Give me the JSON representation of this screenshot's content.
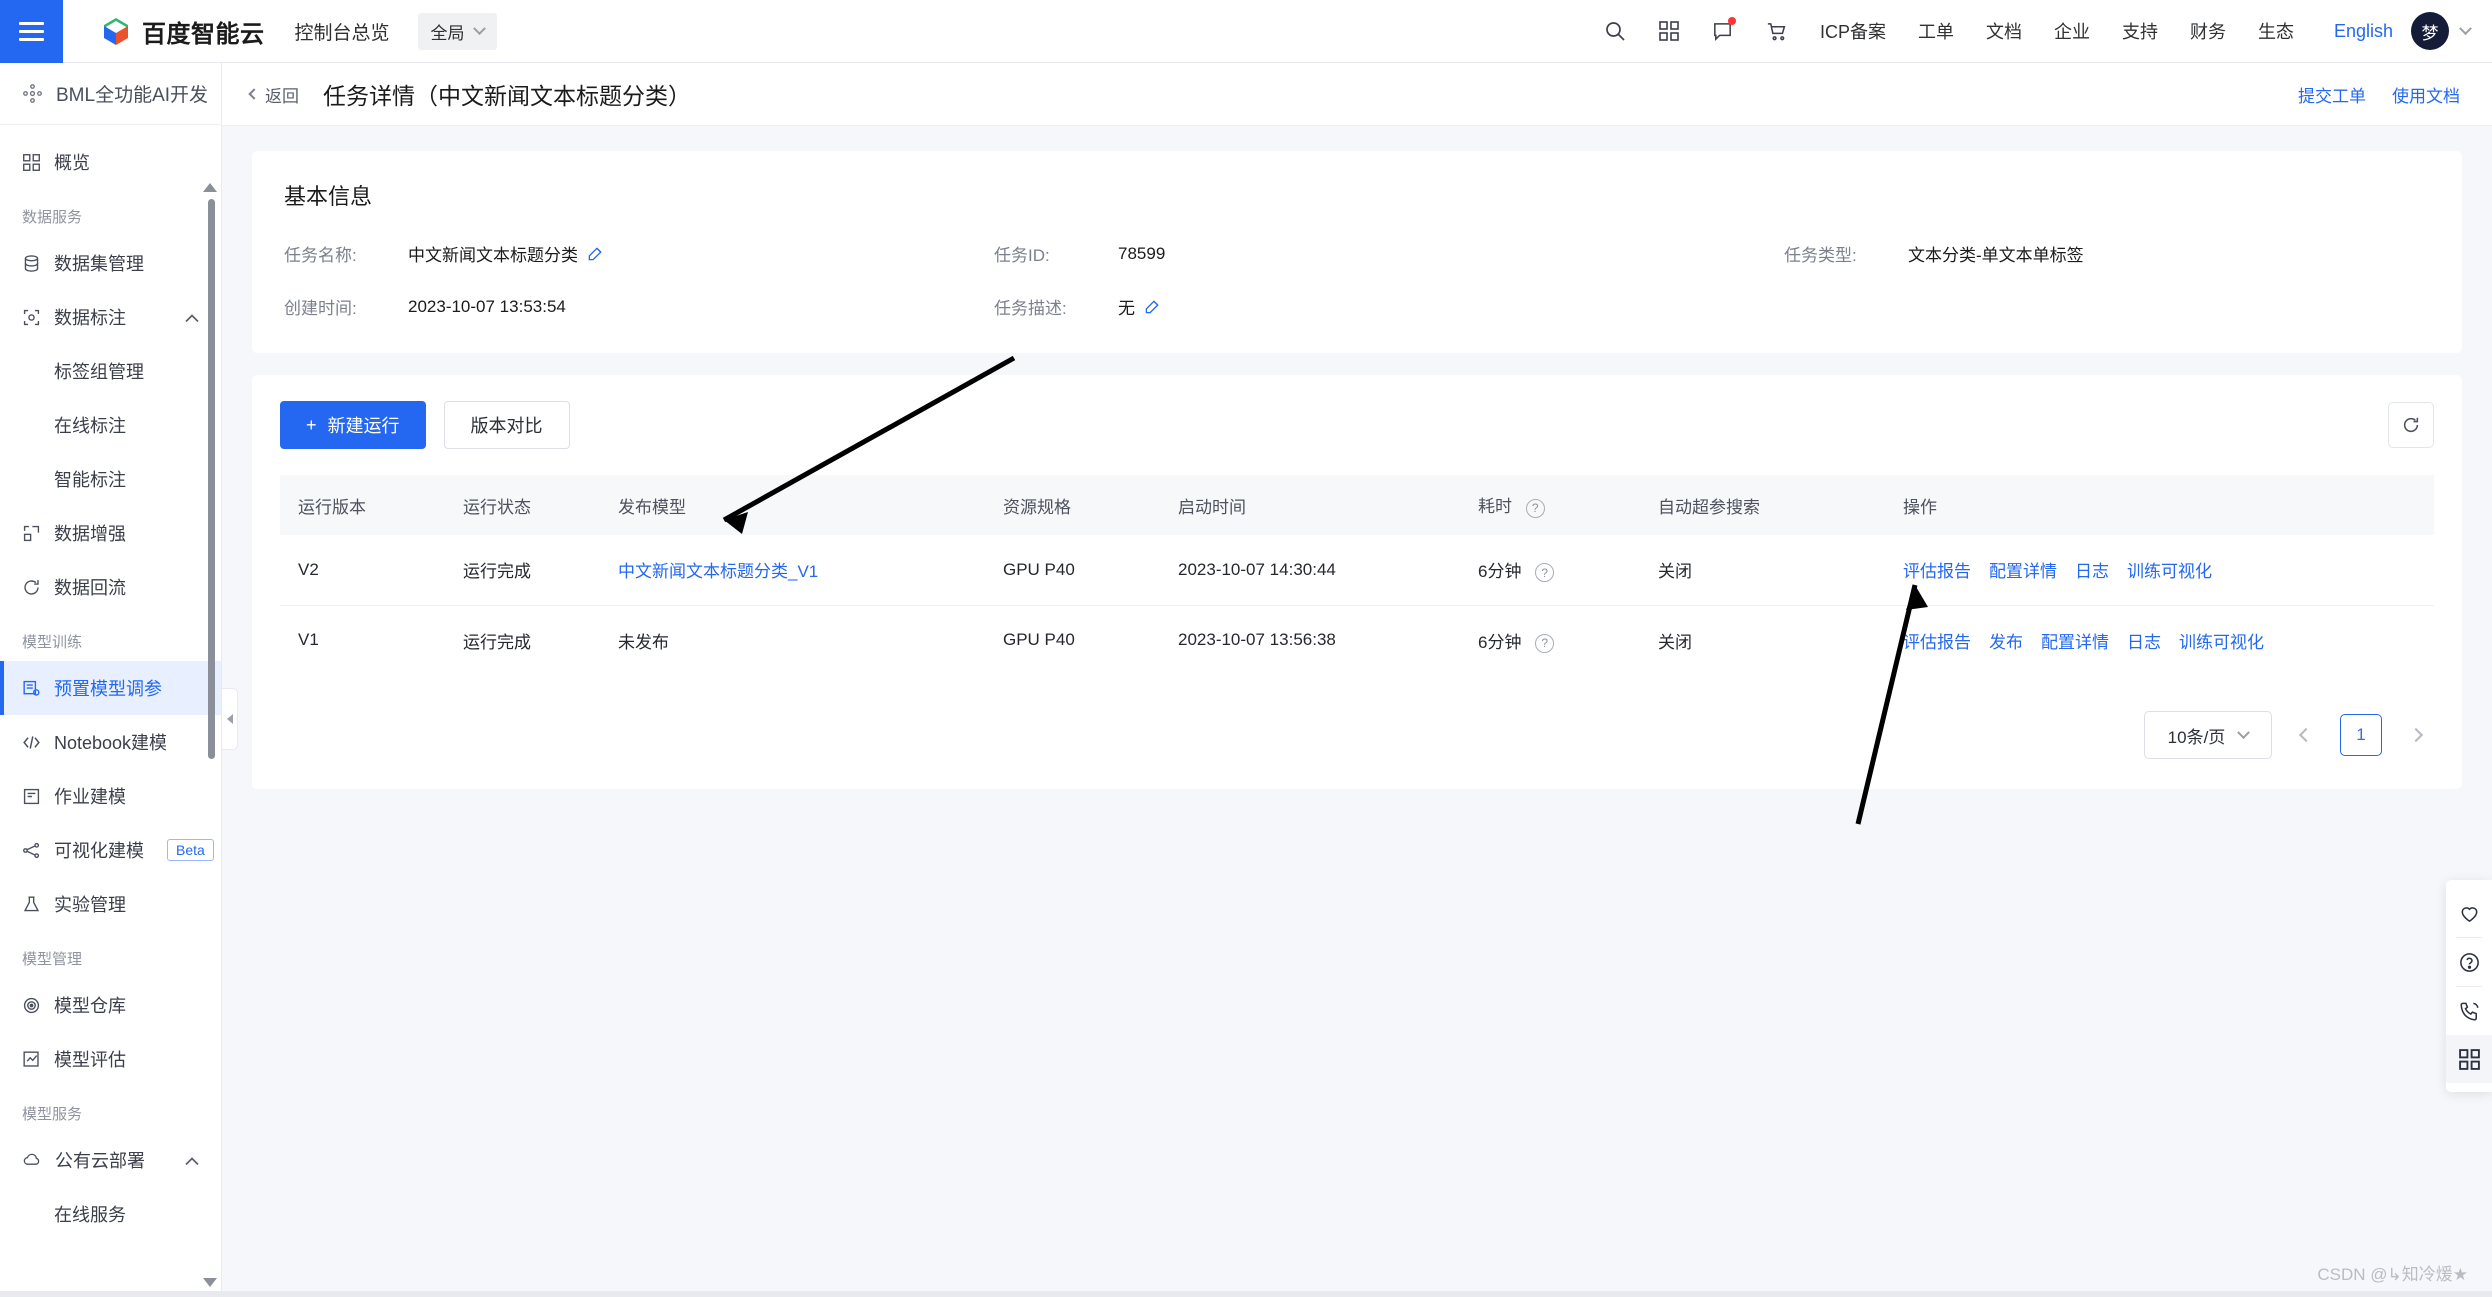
{
  "topbar": {
    "menu_icon": "hamburger-icon",
    "brand": "百度智能云",
    "console": "控制台总览",
    "region": "全局",
    "icons": [
      "search-icon",
      "apps-grid-icon",
      "message-icon",
      "cart-icon"
    ],
    "links": [
      "ICP备案",
      "工单",
      "文档",
      "企业",
      "支持",
      "财务",
      "生态"
    ],
    "english": "English",
    "avatar_text": "梦"
  },
  "sidebar": {
    "product": "BML全功能AI开发",
    "items": [
      {
        "type": "item",
        "label": "概览",
        "icon": "grid-icon",
        "active": false
      },
      {
        "type": "group",
        "label": "数据服务"
      },
      {
        "type": "item",
        "label": "数据集管理",
        "icon": "database-icon",
        "active": false
      },
      {
        "type": "item",
        "label": "数据标注",
        "icon": "target-icon",
        "active": false,
        "caret": "chevron-up"
      },
      {
        "type": "sub",
        "label": "标签组管理"
      },
      {
        "type": "sub",
        "label": "在线标注"
      },
      {
        "type": "sub",
        "label": "智能标注"
      },
      {
        "type": "item",
        "label": "数据增强",
        "icon": "expand-icon",
        "active": false
      },
      {
        "type": "item",
        "label": "数据回流",
        "icon": "refresh-cw-icon",
        "active": false
      },
      {
        "type": "group",
        "label": "模型训练"
      },
      {
        "type": "item",
        "label": "预置模型调参",
        "icon": "preset-model-icon",
        "active": true
      },
      {
        "type": "item",
        "label": "Notebook建模",
        "icon": "code-icon",
        "active": false
      },
      {
        "type": "item",
        "label": "作业建模",
        "icon": "doc-icon",
        "active": false
      },
      {
        "type": "item",
        "label": "可视化建模",
        "icon": "nodes-icon",
        "active": false,
        "badge": "Beta"
      },
      {
        "type": "item",
        "label": "实验管理",
        "icon": "flask-icon",
        "active": false
      },
      {
        "type": "group",
        "label": "模型管理"
      },
      {
        "type": "item",
        "label": "模型仓库",
        "icon": "target-ring-icon",
        "active": false
      },
      {
        "type": "item",
        "label": "模型评估",
        "icon": "chart-check-icon",
        "active": false
      },
      {
        "type": "group",
        "label": "模型服务"
      },
      {
        "type": "item",
        "label": "公有云部署",
        "icon": "cloud-icon",
        "active": false,
        "caret": "chevron-up"
      },
      {
        "type": "sub",
        "label": "在线服务"
      }
    ]
  },
  "page_head": {
    "back": "返回",
    "title": "任务详情（中文新闻文本标题分类）",
    "actions": [
      "提交工单",
      "使用文档"
    ]
  },
  "basic_info": {
    "title": "基本信息",
    "fields": [
      {
        "label": "任务名称:",
        "value": "中文新闻文本标题分类",
        "editable": true
      },
      {
        "label": "任务ID:",
        "value": "78599",
        "editable": false
      },
      {
        "label": "任务类型:",
        "value": "文本分类-单文本单标签",
        "editable": false
      },
      {
        "label": "创建时间:",
        "value": "2023-10-07 13:53:54",
        "editable": false
      },
      {
        "label": "任务描述:",
        "value": "无",
        "editable": true
      }
    ]
  },
  "toolbar": {
    "new_run": "新建运行",
    "new_run_icon": "plus-icon",
    "compare": "版本对比",
    "refresh_icon": "refresh-icon"
  },
  "table": {
    "columns": [
      {
        "key": "version",
        "label": "运行版本",
        "help": false
      },
      {
        "key": "status",
        "label": "运行状态",
        "help": false
      },
      {
        "key": "model",
        "label": "发布模型",
        "help": false
      },
      {
        "key": "spec",
        "label": "资源规格",
        "help": false
      },
      {
        "key": "start",
        "label": "启动时间",
        "help": false
      },
      {
        "key": "duration",
        "label": "耗时",
        "help": true
      },
      {
        "key": "autohpo",
        "label": "自动超参搜索",
        "help": false
      },
      {
        "key": "ops",
        "label": "操作",
        "help": false
      }
    ],
    "rows": [
      {
        "version": "V2",
        "status": "运行完成",
        "model": "中文新闻文本标题分类_V1",
        "model_is_link": true,
        "spec": "GPU P40",
        "start": "2023-10-07 14:30:44",
        "duration": "6分钟",
        "autohpo": "关闭",
        "ops": [
          "评估报告",
          "配置详情",
          "日志",
          "训练可视化"
        ]
      },
      {
        "version": "V1",
        "status": "运行完成",
        "model": "未发布",
        "model_is_link": false,
        "spec": "GPU P40",
        "start": "2023-10-07 13:56:38",
        "duration": "6分钟",
        "autohpo": "关闭",
        "ops": [
          "评估报告",
          "发布",
          "配置详情",
          "日志",
          "训练可视化"
        ]
      }
    ]
  },
  "pagination": {
    "page_size": "10条/页",
    "current_page": "1",
    "prev_icon": "chevron-left-icon",
    "next_icon": "chevron-right-icon"
  },
  "dock": {
    "items": [
      "heart-icon",
      "question-icon",
      "phone-icon",
      "grid-apps-icon"
    ]
  },
  "watermark": "CSDN @↳知冷煖★",
  "colors": {
    "brand_blue": "#2468f2",
    "success_green": "#30b451",
    "link_blue": "#2468f2",
    "sidebar_active_bg": "#e8f0ff",
    "page_bg": "#f5f7fa"
  }
}
